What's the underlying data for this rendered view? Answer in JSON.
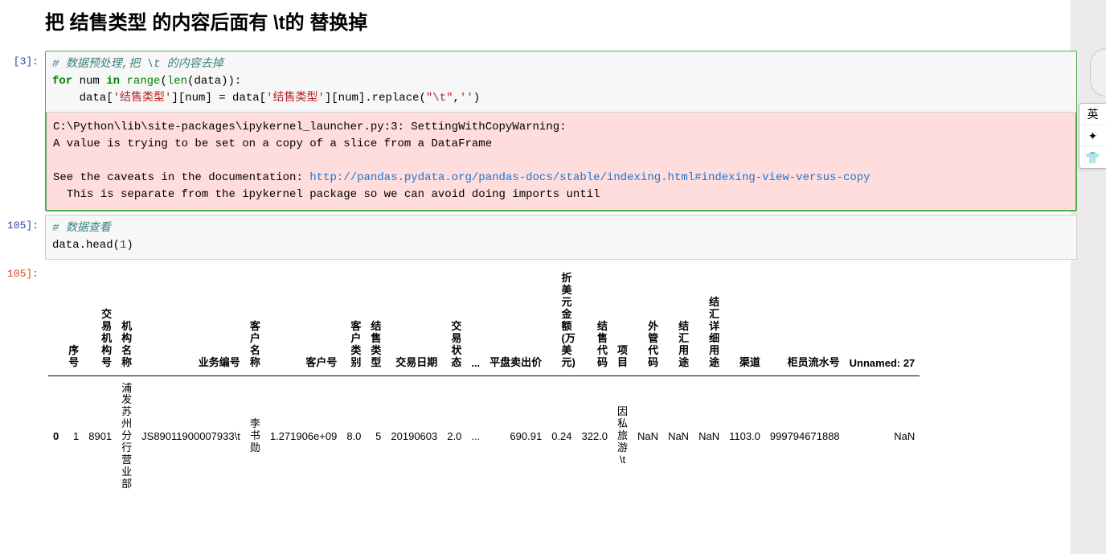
{
  "heading": "把 结售类型 的内容后面有 \\t的 替换掉",
  "cells": [
    {
      "prompt": "[3]:",
      "code_comment": "# 数据预处理,把 \\t 的内容去掉",
      "code_line2_pre": "for",
      "code_line2_num": " num ",
      "code_line2_in": "in",
      "code_line2_range": " range",
      "code_line2_len": "len",
      "code_line2_rest": "(data)):",
      "code_line3_a": "    data[",
      "code_line3_s1": "'结售类型'",
      "code_line3_b": "][num] = data[",
      "code_line3_s2": "'结售类型'",
      "code_line3_c": "][num].replace(",
      "code_line3_s3": "\"\\t\"",
      "code_line3_d": ",",
      "code_line3_s4": "''",
      "code_line3_e": ")"
    }
  ],
  "warning": {
    "line1": "C:\\Python\\lib\\site-packages\\ipykernel_launcher.py:3: SettingWithCopyWarning: ",
    "line2": "A value is trying to be set on a copy of a slice from a DataFrame",
    "line3": "",
    "line4_pre": "See the caveats in the documentation: ",
    "line4_link": "http://pandas.pydata.org/pandas-docs/stable/indexing.html#indexing-view-versus-copy",
    "line5": "  This is separate from the ipykernel package so we can avoid doing imports until"
  },
  "cell2": {
    "prompt": "105]:",
    "comment": "# 数据查看",
    "code": "data.head(",
    "arg": "1",
    "close": ")"
  },
  "out_prompt": "105]:",
  "table": {
    "headers": [
      "",
      "序号",
      "交易机构号",
      "机构名称",
      "业务编号",
      "客户名称",
      "客户号",
      "客户类别",
      "结售类型",
      "交易日期",
      "交易状态",
      "...",
      "平盘卖出价",
      "折美元金额(万美元)",
      "结售代码",
      "项目",
      "外管代码",
      "结汇用途",
      "结汇详细用途",
      "渠道",
      "柜员流水号",
      "Unnamed: 27"
    ],
    "vertical_cols": [
      1,
      2,
      3,
      5,
      7,
      8,
      10,
      13,
      14,
      15,
      16,
      17,
      18
    ],
    "row": {
      "idx": "0",
      "cells": [
        "1",
        "8901",
        "浦发苏州分行营业部",
        "JS89011900007933\\t",
        "李书勋",
        "1.271906e+09",
        "8.0",
        "5",
        "20190603",
        "2.0",
        "...",
        "690.91",
        "0.24",
        "322.0",
        "因私旅游\\t",
        "NaN",
        "NaN",
        "NaN",
        "1103.0",
        "999794671888",
        "NaN"
      ],
      "vertical_cells": [
        2,
        4,
        14
      ]
    }
  },
  "ime": {
    "lang": "英",
    "sym": "✦",
    "shirt": "👕"
  }
}
